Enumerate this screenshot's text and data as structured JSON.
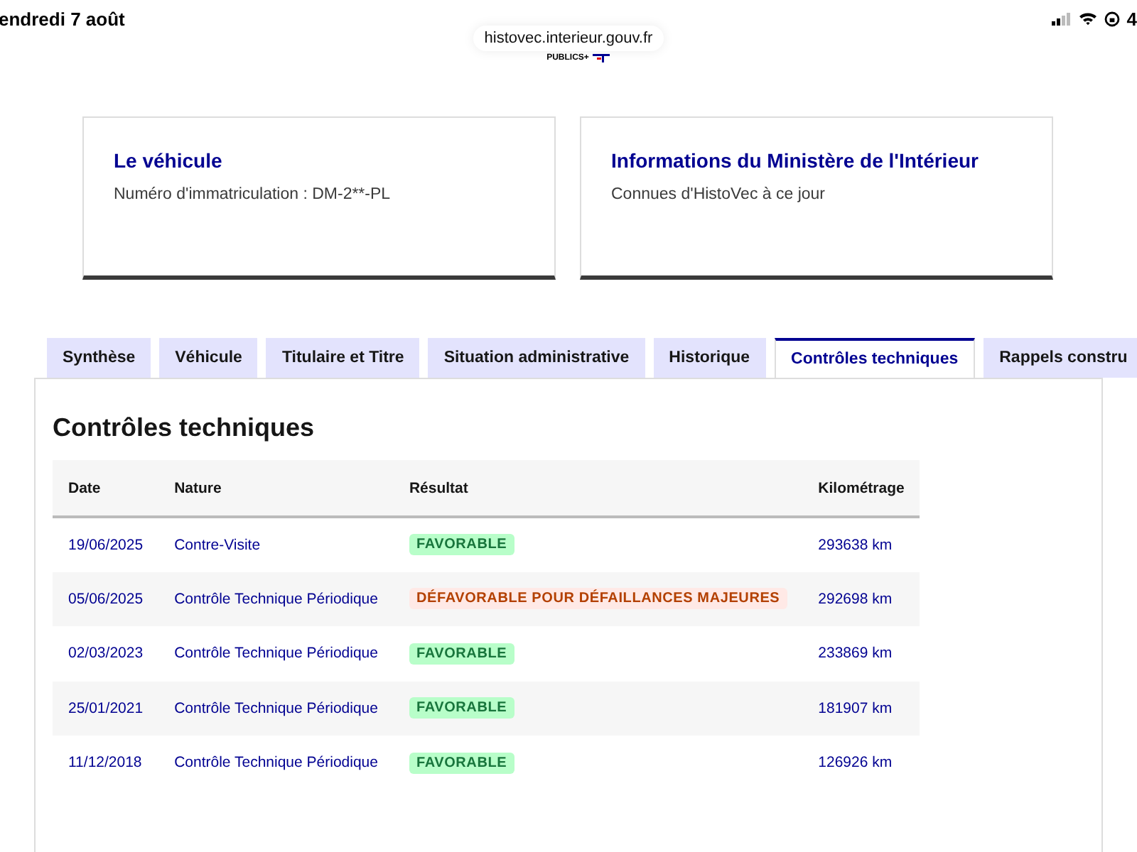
{
  "status_bar": {
    "date": "endredi 7 août",
    "battery": "4"
  },
  "address_bar": {
    "url": "histovec.interieur.gouv.fr"
  },
  "logo": {
    "text": "PUBLICS+"
  },
  "cards": [
    {
      "title": "Le véhicule",
      "text": "Numéro d'immatriculation : DM-2**-PL"
    },
    {
      "title": "Informations du Ministère de l'Intérieur",
      "text": "Connues d'HistoVec à ce jour"
    }
  ],
  "tabs": [
    {
      "label": "Synthèse",
      "selected": false
    },
    {
      "label": "Véhicule",
      "selected": false
    },
    {
      "label": "Titulaire et Titre",
      "selected": false
    },
    {
      "label": "Situation administrative",
      "selected": false
    },
    {
      "label": "Historique",
      "selected": false
    },
    {
      "label": "Contrôles techniques",
      "selected": true
    },
    {
      "label": "Rappels constru",
      "selected": false
    }
  ],
  "section": {
    "title": "Contrôles techniques"
  },
  "table": {
    "columns": [
      "Date",
      "Nature",
      "Résultat",
      "Kilométrage"
    ],
    "rows": [
      {
        "date": "19/06/2025",
        "nature": "Contre-Visite",
        "result": {
          "kind": "favorable",
          "text": "FAVORABLE"
        },
        "km": "293638 km"
      },
      {
        "date": "05/06/2025",
        "nature": "Contrôle Technique Périodique",
        "result": {
          "kind": "defavorable",
          "text": "DÉFAVORABLE POUR DÉFAILLANCES MAJEURES"
        },
        "km": "292698 km"
      },
      {
        "date": "02/03/2023",
        "nature": "Contrôle Technique Périodique",
        "result": {
          "kind": "favorable",
          "text": "FAVORABLE"
        },
        "km": "233869 km"
      },
      {
        "date": "25/01/2021",
        "nature": "Contrôle Technique Périodique",
        "result": {
          "kind": "favorable",
          "text": "FAVORABLE"
        },
        "km": "181907 km"
      },
      {
        "date": "11/12/2018",
        "nature": "Contrôle Technique Périodique",
        "result": {
          "kind": "favorable",
          "text": "FAVORABLE"
        },
        "km": "126926 km"
      }
    ]
  }
}
